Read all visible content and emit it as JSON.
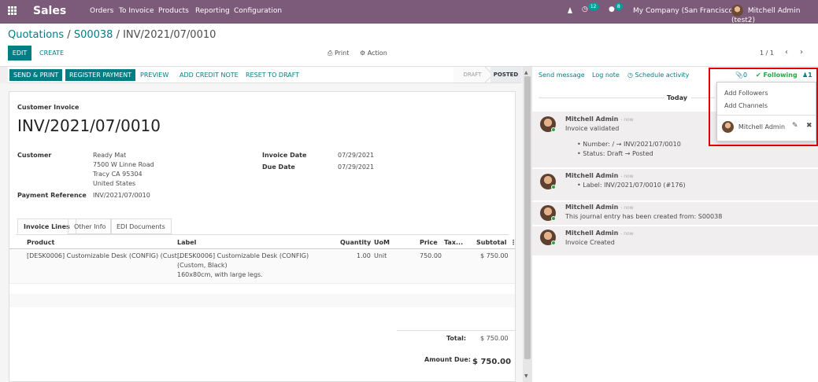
{
  "navbar": {
    "app_name": "Sales",
    "menu": [
      "Orders",
      "To Invoice",
      "Products",
      "Reporting",
      "Configuration"
    ],
    "activity_count": "12",
    "message_count": "8",
    "company": "My Company (San Francisco)",
    "user": "Mitchell Admin (test2)"
  },
  "breadcrumb": {
    "root": "Quotations",
    "sep1": " / ",
    "order": "S00038",
    "sep2": " / ",
    "current": "INV/2021/07/0010"
  },
  "control": {
    "edit": "EDIT",
    "create": "CREATE",
    "print": "Print",
    "action": "Action",
    "pager": "1 / 1"
  },
  "statusbar": {
    "buttons": [
      "SEND & PRINT",
      "REGISTER PAYMENT",
      "PREVIEW",
      "ADD CREDIT NOTE",
      "RESET TO DRAFT"
    ],
    "stage_draft": "DRAFT",
    "stage_posted": "POSTED"
  },
  "invoice": {
    "type_label": "Customer Invoice",
    "number": "INV/2021/07/0010",
    "customer_label": "Customer",
    "customer_name": "Ready Mat",
    "address": [
      "7500 W Linne Road",
      "Tracy CA 95304",
      "United States"
    ],
    "payment_ref_label": "Payment Reference",
    "payment_ref": "INV/2021/07/0010",
    "invoice_date_label": "Invoice Date",
    "invoice_date": "07/29/2021",
    "due_date_label": "Due Date",
    "due_date": "07/29/2021"
  },
  "tabs": [
    "Invoice Lines",
    "Other Info",
    "EDI Documents"
  ],
  "lines": {
    "headers": [
      "Product",
      "Label",
      "Quantity",
      "UoM",
      "Price",
      "Tax...",
      "Subtotal"
    ],
    "row": {
      "product": "[DESK0006] Customizable Desk (CONFIG) (Cust...",
      "label": [
        "[DESK0006] Customizable Desk (CONFIG)",
        "(Custom, Black)",
        "160x80cm, with large legs."
      ],
      "quantity": "1.00",
      "uom": "Unit",
      "price": "750.00",
      "tax": "",
      "subtotal": "$ 750.00"
    }
  },
  "totals": {
    "total_label": "Total:",
    "total": "$ 750.00",
    "amount_due_label": "Amount Due:",
    "amount_due": "$ 750.00"
  },
  "chatter": {
    "send_message": "Send message",
    "log_note": "Log note",
    "schedule_activity": "Schedule activity",
    "attachments": "0",
    "following": "Following",
    "followers": "1",
    "today": "Today",
    "messages": [
      {
        "author": "Mitchell Admin",
        "when": "- now",
        "lines": [
          "Invoice validated"
        ],
        "bullets": [
          "Number: / → INV/2021/07/0010",
          "Status: Draft → Posted"
        ]
      },
      {
        "author": "Mitchell Admin",
        "when": "- now",
        "lines": [],
        "bullets": [
          "Label:  INV/2021/07/0010 (#176)"
        ]
      },
      {
        "author": "Mitchell Admin",
        "when": "- now",
        "lines": [
          "This journal entry has been created from: S00038"
        ],
        "bullets": []
      },
      {
        "author": "Mitchell Admin",
        "when": "- now",
        "lines": [
          "Invoice Created"
        ],
        "bullets": []
      }
    ]
  },
  "followers_dropdown": {
    "add_followers": "Add Followers",
    "add_channels": "Add Channels",
    "follower_name": "Mitchell Admin"
  },
  "colors": {
    "navbar": "#7c5a79",
    "primary": "#017e84",
    "following": "#28a745",
    "highlight": "#e00000"
  }
}
